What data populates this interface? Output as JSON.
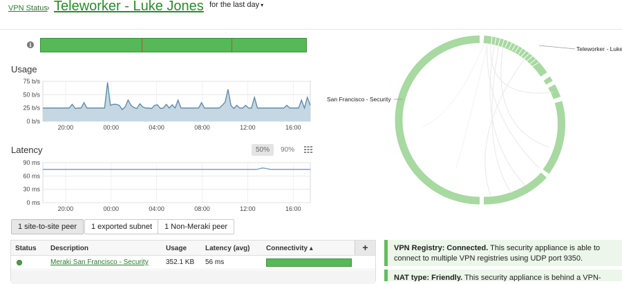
{
  "header": {
    "breadcrumb": "VPN Status",
    "breadcrumb_sep": "›",
    "title": "Teleworker - Luke Jones",
    "period": "for the last day",
    "period_caret": "▾"
  },
  "colors": {
    "accent_green": "#56b856",
    "chart_fill": "#c5d7e3",
    "chart_line": "#5b87a5",
    "latency_line": "#6d9bb8",
    "ring_green": "#a7d9a1"
  },
  "icons": {
    "info": "info-icon",
    "grid": "grid-icon",
    "plus": "plus-icon",
    "status": "status-dot-icon"
  },
  "info_glyph": "i",
  "chart_data": [
    {
      "type": "area",
      "title": "Usage",
      "ylim": [
        0,
        75
      ],
      "y_ticks": [
        "0 b/s",
        "25 b/s",
        "50 b/s",
        "75 b/s"
      ],
      "y_tick_values": [
        0,
        25,
        50,
        75
      ],
      "x_ticks": [
        "20:00",
        "00:00",
        "04:00",
        "08:00",
        "12:00",
        "16:00"
      ],
      "x_tick_positions": [
        2,
        6,
        10,
        14,
        18,
        22
      ],
      "x_range": [
        0,
        23.5
      ],
      "grid": true,
      "series": [
        {
          "values": [
            25,
            25,
            25,
            25,
            25,
            25,
            25,
            25,
            25,
            25,
            32,
            24,
            25,
            25,
            35,
            25,
            25,
            25,
            25,
            25,
            25,
            25,
            73,
            30,
            32,
            32,
            30,
            22,
            27,
            40,
            30,
            26,
            24,
            33,
            27,
            25,
            25,
            24,
            30,
            31,
            24,
            25,
            32,
            25,
            31,
            25,
            40,
            25,
            25,
            25,
            25,
            25,
            25,
            25,
            35,
            25,
            25,
            25,
            25,
            25,
            25,
            30,
            36,
            60,
            30,
            24,
            30,
            25,
            25,
            30,
            25,
            25,
            45,
            25,
            25,
            25,
            25,
            25,
            25,
            25,
            25,
            25,
            25,
            30,
            25,
            25,
            25,
            25,
            40,
            25,
            45,
            30
          ]
        }
      ]
    },
    {
      "type": "line",
      "title": "Latency",
      "ylim": [
        0,
        90
      ],
      "y_ticks": [
        "0 ms",
        "30 ms",
        "60 ms",
        "90 ms"
      ],
      "y_tick_values": [
        0,
        30,
        60,
        90
      ],
      "x_ticks": [
        "20:00",
        "00:00",
        "04:00",
        "08:00",
        "12:00",
        "16:00"
      ],
      "x_tick_positions": [
        2,
        6,
        10,
        14,
        18,
        22
      ],
      "x_range": [
        0,
        23.5
      ],
      "grid": true,
      "series": [
        {
          "x": [
            0,
            18.8,
            19.3,
            19.6,
            20.0,
            23.5
          ],
          "values": [
            75,
            75,
            78,
            77,
            75,
            75
          ]
        }
      ]
    }
  ],
  "latency": {
    "pct_50": "50%",
    "pct_90": "90%"
  },
  "status_bar": {
    "markers": [
      0.38,
      0.72
    ]
  },
  "peers": {
    "tabs": [
      {
        "label": "1 site-to-site peer"
      },
      {
        "label": "1 exported subnet"
      },
      {
        "label": "1 Non-Meraki peer"
      }
    ]
  },
  "table": {
    "headers": {
      "status": "Status",
      "description": "Description",
      "usage": "Usage",
      "latency": "Latency (avg)",
      "connectivity": "Connectivity ▴"
    },
    "plus": "+",
    "rows": [
      {
        "description": "Meraki San Francisco - Security",
        "usage": "352.1 KB",
        "latency": "56 ms",
        "connectivity": 1.0
      }
    ]
  },
  "ring": {
    "labels": {
      "teleworker": "Teleworker - Luke",
      "san_francisco": "San Francisco - Security"
    }
  },
  "notes": {
    "registry_bold": "VPN Registry: Connected.",
    "registry_text": " This security appliance is able to connect to multiple VPN registries using UDP port 9350.",
    "nat_bold": "NAT type: Friendly.",
    "nat_text": " This security appliance is behind a VPN-"
  }
}
